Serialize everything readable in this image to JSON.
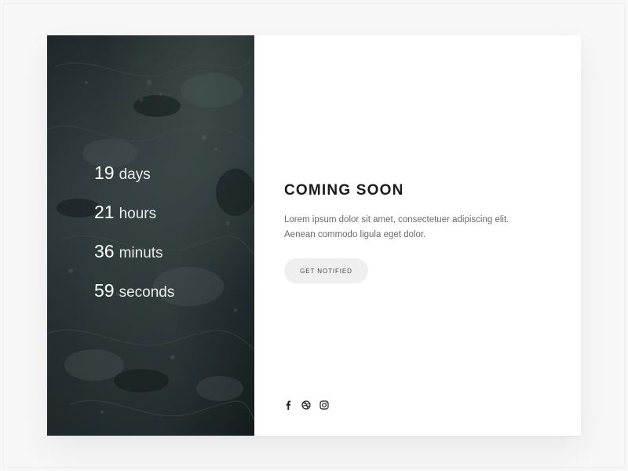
{
  "countdown": {
    "items": [
      {
        "value": "19",
        "unit": "days"
      },
      {
        "value": "21",
        "unit": "hours"
      },
      {
        "value": "36",
        "unit": "minuts"
      },
      {
        "value": "59",
        "unit": "seconds"
      }
    ]
  },
  "main": {
    "title": "COMING SOON",
    "description_line1": "Lorem ipsum dolor sit amet, consectetuer adipiscing elit.",
    "description_line2": "Aenean commodo ligula eget dolor.",
    "button_label": "GET NOTIFIED"
  },
  "social": {
    "icons": [
      "facebook-icon",
      "dribbble-icon",
      "instagram-icon"
    ]
  },
  "colors": {
    "panel_dark": "#1d2628",
    "background": "#f7f7f7",
    "button_bg": "#efefef",
    "title_text": "#1b1b1b"
  }
}
